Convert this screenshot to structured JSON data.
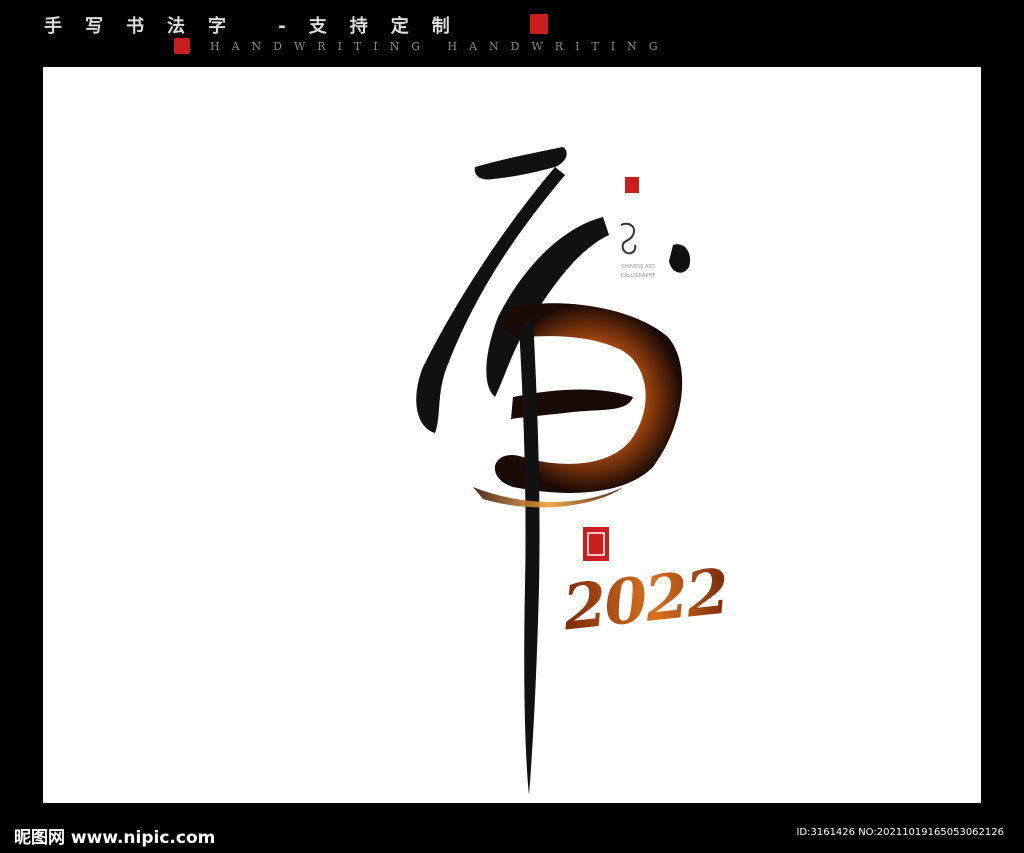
{
  "header": {
    "title": "手写书法字 -支持定制",
    "subtitle": "HANDWRITING HANDWRITING"
  },
  "artwork": {
    "seal_caption": "CHINESE ART CALLIGRAPHY",
    "year": "2022",
    "ink_color": "#111111",
    "glow_color": "#e8861c",
    "seal_color": "#c81e1e"
  },
  "footer": {
    "logo": "昵图网 www.nipic.com",
    "id_text": "ID:3161426 NO:20211019165053062126"
  }
}
